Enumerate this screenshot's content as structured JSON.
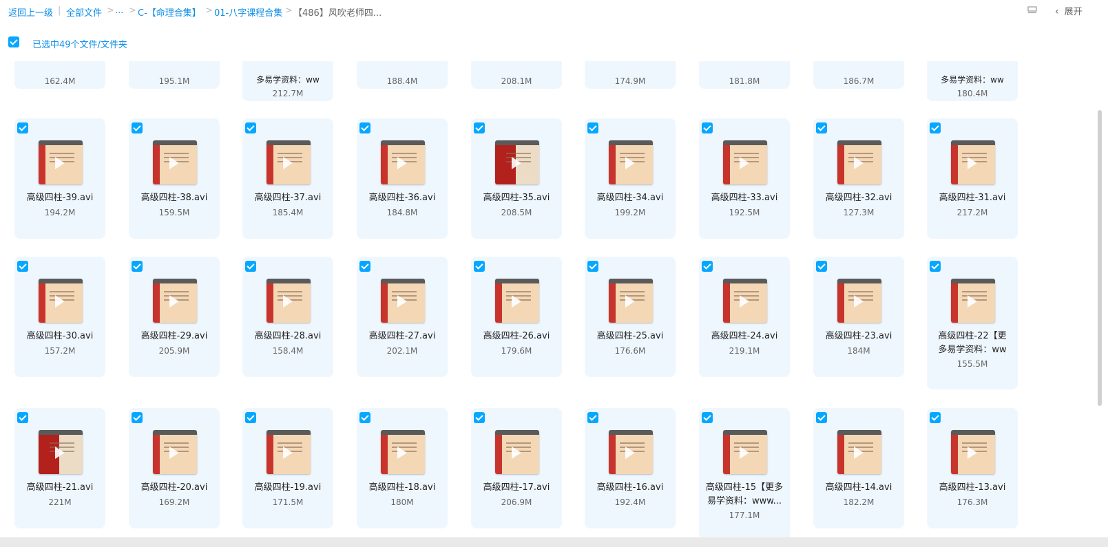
{
  "breadcrumb": {
    "back": "返回上一级",
    "all_files": "全部文件",
    "ellipsis": "...",
    "folder1": "C-【命理合集】",
    "folder2": "01-八字课程合集",
    "current": "【486】风吹老师四..."
  },
  "header": {
    "expand_label": "展开",
    "view_icon": "list-view-icon"
  },
  "selection": {
    "text": "已选中49个文件/文件夹"
  },
  "rows": [
    {
      "partial": true,
      "items": [
        {
          "size": "162.4M"
        },
        {
          "size": "195.1M"
        },
        {
          "name": "多易学资料：ww",
          "size": "212.7M"
        },
        {
          "size": "188.4M"
        },
        {
          "size": "208.1M"
        },
        {
          "size": "174.9M"
        },
        {
          "size": "181.8M"
        },
        {
          "size": "186.7M"
        },
        {
          "name": "多易学资料：ww",
          "size": "180.4M"
        }
      ]
    },
    {
      "items": [
        {
          "name": "高级四柱-39.avi",
          "size": "194.2M"
        },
        {
          "name": "高级四柱-38.avi",
          "size": "159.5M"
        },
        {
          "name": "高级四柱-37.avi",
          "size": "185.4M"
        },
        {
          "name": "高级四柱-36.avi",
          "size": "184.8M"
        },
        {
          "name": "高级四柱-35.avi",
          "size": "208.5M",
          "thumb": "red"
        },
        {
          "name": "高级四柱-34.avi",
          "size": "199.2M"
        },
        {
          "name": "高级四柱-33.avi",
          "size": "192.5M"
        },
        {
          "name": "高级四柱-32.avi",
          "size": "127.3M"
        },
        {
          "name": "高级四柱-31.avi",
          "size": "217.2M"
        }
      ]
    },
    {
      "items": [
        {
          "name": "高级四柱-30.avi",
          "size": "157.2M"
        },
        {
          "name": "高级四柱-29.avi",
          "size": "205.9M"
        },
        {
          "name": "高级四柱-28.avi",
          "size": "158.4M"
        },
        {
          "name": "高级四柱-27.avi",
          "size": "202.1M"
        },
        {
          "name": "高级四柱-26.avi",
          "size": "179.6M"
        },
        {
          "name": "高级四柱-25.avi",
          "size": "176.6M"
        },
        {
          "name": "高级四柱-24.avi",
          "size": "219.1M"
        },
        {
          "name": "高级四柱-23.avi",
          "size": "184M"
        },
        {
          "name": "高级四柱-22【更",
          "name2": "多易学资料：ww",
          "size": "155.5M"
        }
      ]
    },
    {
      "items": [
        {
          "name": "高级四柱-21.avi",
          "size": "221M",
          "thumb": "red"
        },
        {
          "name": "高级四柱-20.avi",
          "size": "169.2M"
        },
        {
          "name": "高级四柱-19.avi",
          "size": "171.5M"
        },
        {
          "name": "高级四柱-18.avi",
          "size": "180M"
        },
        {
          "name": "高级四柱-17.avi",
          "size": "206.9M"
        },
        {
          "name": "高级四柱-16.avi",
          "size": "192.4M"
        },
        {
          "name": "高级四柱-15【更多",
          "name2": "易学资料：www...",
          "size": "177.1M"
        },
        {
          "name": "高级四柱-14.avi",
          "size": "182.2M"
        },
        {
          "name": "高级四柱-13.avi",
          "size": "176.3M"
        }
      ]
    }
  ]
}
